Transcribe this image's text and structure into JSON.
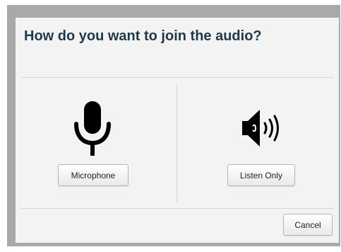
{
  "dialog": {
    "title": "How do you want to join the audio?",
    "options": [
      {
        "label": "Microphone",
        "icon": "microphone-icon"
      },
      {
        "label": "Listen Only",
        "icon": "speaker-icon"
      }
    ],
    "cancel_label": "Cancel"
  },
  "colors": {
    "title": "#1e3a4a",
    "dialog_bg": "#f3f3f3",
    "frame": "#a9a9a9",
    "icon": "#000000"
  }
}
